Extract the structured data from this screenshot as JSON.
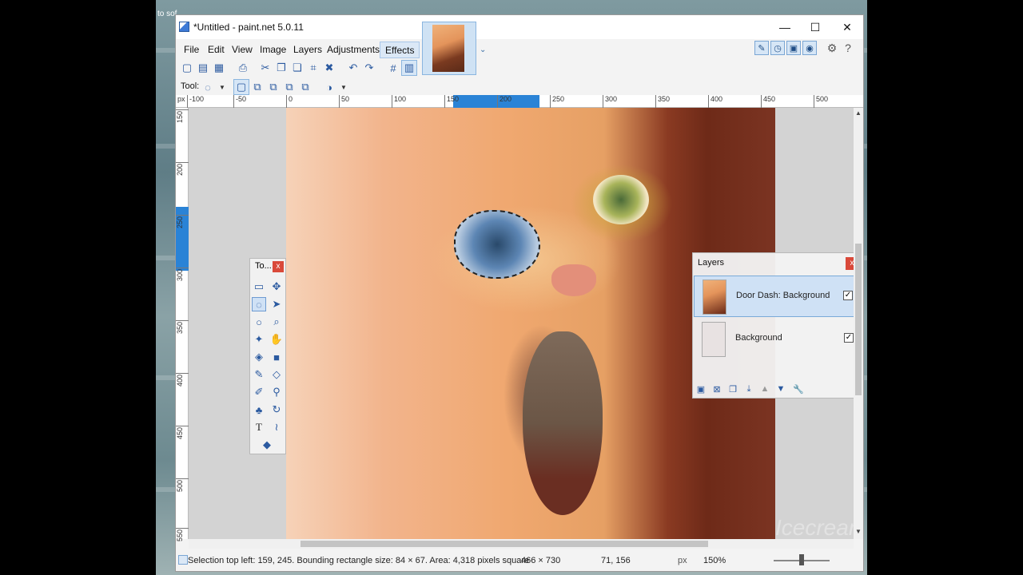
{
  "desktop": {
    "corner_text": "to sof"
  },
  "window": {
    "title": "*Untitled - paint.net 5.0.11",
    "minimize_glyph": "—",
    "maximize_glyph": "☐",
    "close_glyph": "✕"
  },
  "menu": {
    "items": [
      {
        "label": "File"
      },
      {
        "label": "Edit"
      },
      {
        "label": "View"
      },
      {
        "label": "Image"
      },
      {
        "label": "Layers"
      },
      {
        "label": "Adjustments"
      },
      {
        "label": "Effects"
      }
    ],
    "active": "Effects"
  },
  "toolbar2": {
    "tool_label": "Tool:"
  },
  "rulers": {
    "unit": "px",
    "horizontal_ticks": [
      "-100",
      "-50",
      "0",
      "50",
      "100",
      "150",
      "200",
      "250",
      "300",
      "350",
      "400",
      "450",
      "500"
    ],
    "vertical_ticks": [
      "150",
      "200",
      "250",
      "300",
      "350",
      "400",
      "450",
      "500",
      "550"
    ]
  },
  "tools_panel": {
    "title": "To...",
    "close_glyph": "x"
  },
  "layers_panel": {
    "title": "Layers",
    "close_glyph": "x",
    "layers": [
      {
        "name": "Door Dash: Background",
        "visible": true,
        "selected": true
      },
      {
        "name": "Background",
        "visible": true,
        "selected": false
      }
    ]
  },
  "status": {
    "selection_text": "Selection top left: 159, 245. Bounding rectangle size: 84 × 67. Area: 4,318 pixels square",
    "image_size": "466 × 730",
    "cursor_pos": "71, 156",
    "unit": "px",
    "zoom": "150%"
  },
  "canvas": {
    "watermark": "Icecream"
  },
  "colors": {
    "accent": "#2a83d6",
    "close_red": "#d9493a",
    "selection_bg": "#cfe1f5"
  },
  "icons": [
    "app-icon",
    "new-icon",
    "open-icon",
    "save-icon",
    "print-icon",
    "cut-icon",
    "copy-icon",
    "paste-icon",
    "crop-icon",
    "deselect-icon",
    "undo-icon",
    "redo-icon",
    "grid-icon",
    "ruler-icon",
    "lasso-icon",
    "settings-icon",
    "help-icon"
  ]
}
